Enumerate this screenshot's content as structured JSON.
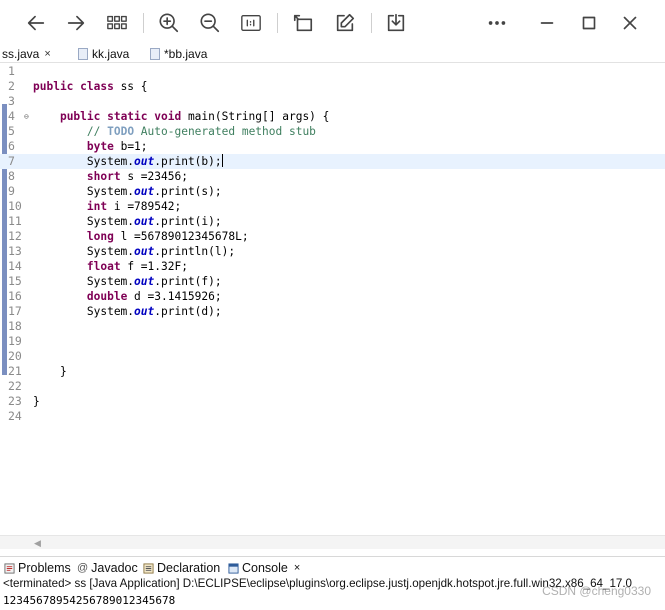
{
  "editor_tabs": [
    {
      "label": "ss.java",
      "close": "×"
    },
    {
      "label": "kk.java",
      "close": ""
    },
    {
      "label": "*bb.java",
      "close": ""
    }
  ],
  "code_lines": [
    {
      "n": "1",
      "fold": "",
      "current": false,
      "tokens": []
    },
    {
      "n": "2",
      "fold": "",
      "current": false,
      "tokens": [
        {
          "t": "public class",
          "c": "kw"
        },
        {
          "t": " ss {",
          "c": ""
        }
      ]
    },
    {
      "n": "3",
      "fold": "",
      "current": false,
      "tokens": []
    },
    {
      "n": "4",
      "fold": "⊖",
      "current": false,
      "tokens": [
        {
          "t": "    ",
          "c": ""
        },
        {
          "t": "public static void",
          "c": "kw"
        },
        {
          "t": " main(String[] args) {",
          "c": ""
        }
      ]
    },
    {
      "n": "5",
      "fold": "",
      "current": false,
      "tokens": [
        {
          "t": "        ",
          "c": ""
        },
        {
          "t": "// ",
          "c": "cm"
        },
        {
          "t": "TODO",
          "c": "todo"
        },
        {
          "t": " Auto-generated method stub",
          "c": "cm"
        }
      ]
    },
    {
      "n": "6",
      "fold": "",
      "current": false,
      "tokens": [
        {
          "t": "        ",
          "c": ""
        },
        {
          "t": "byte",
          "c": "kw"
        },
        {
          "t": " b=1;",
          "c": ""
        }
      ]
    },
    {
      "n": "7",
      "fold": "",
      "current": true,
      "tokens": [
        {
          "t": "        System.",
          "c": ""
        },
        {
          "t": "out",
          "c": "fld"
        },
        {
          "t": ".print(b);",
          "c": ""
        },
        {
          "t": "|",
          "c": "cursor"
        }
      ]
    },
    {
      "n": "8",
      "fold": "",
      "current": false,
      "tokens": [
        {
          "t": "        ",
          "c": ""
        },
        {
          "t": "short",
          "c": "kw"
        },
        {
          "t": " s =23456;",
          "c": ""
        }
      ]
    },
    {
      "n": "9",
      "fold": "",
      "current": false,
      "tokens": [
        {
          "t": "        System.",
          "c": ""
        },
        {
          "t": "out",
          "c": "fld"
        },
        {
          "t": ".print(s);",
          "c": ""
        }
      ]
    },
    {
      "n": "10",
      "fold": "",
      "current": false,
      "tokens": [
        {
          "t": "        ",
          "c": ""
        },
        {
          "t": "int",
          "c": "kw"
        },
        {
          "t": " i =789542;",
          "c": ""
        }
      ]
    },
    {
      "n": "11",
      "fold": "",
      "current": false,
      "tokens": [
        {
          "t": "        System.",
          "c": ""
        },
        {
          "t": "out",
          "c": "fld"
        },
        {
          "t": ".print(i);",
          "c": ""
        }
      ]
    },
    {
      "n": "12",
      "fold": "",
      "current": false,
      "tokens": [
        {
          "t": "        ",
          "c": ""
        },
        {
          "t": "long",
          "c": "kw"
        },
        {
          "t": " l =56789012345678L;",
          "c": ""
        }
      ]
    },
    {
      "n": "13",
      "fold": "",
      "current": false,
      "tokens": [
        {
          "t": "        System.",
          "c": ""
        },
        {
          "t": "out",
          "c": "fld"
        },
        {
          "t": ".println(l);",
          "c": ""
        }
      ]
    },
    {
      "n": "14",
      "fold": "",
      "current": false,
      "tokens": [
        {
          "t": "        ",
          "c": ""
        },
        {
          "t": "float",
          "c": "kw"
        },
        {
          "t": " f =1.32F;",
          "c": ""
        }
      ]
    },
    {
      "n": "15",
      "fold": "",
      "current": false,
      "tokens": [
        {
          "t": "        System.",
          "c": ""
        },
        {
          "t": "out",
          "c": "fld"
        },
        {
          "t": ".print(f);",
          "c": ""
        }
      ]
    },
    {
      "n": "16",
      "fold": "",
      "current": false,
      "tokens": [
        {
          "t": "        ",
          "c": ""
        },
        {
          "t": "double",
          "c": "kw"
        },
        {
          "t": " d =3.1415926;",
          "c": ""
        }
      ]
    },
    {
      "n": "17",
      "fold": "",
      "current": false,
      "tokens": [
        {
          "t": "        System.",
          "c": ""
        },
        {
          "t": "out",
          "c": "fld"
        },
        {
          "t": ".print(d);",
          "c": ""
        }
      ]
    },
    {
      "n": "18",
      "fold": "",
      "current": false,
      "tokens": []
    },
    {
      "n": "19",
      "fold": "",
      "current": false,
      "tokens": []
    },
    {
      "n": "20",
      "fold": "",
      "current": false,
      "tokens": []
    },
    {
      "n": "21",
      "fold": "",
      "current": false,
      "tokens": [
        {
          "t": "    }",
          "c": ""
        }
      ]
    },
    {
      "n": "22",
      "fold": "",
      "current": false,
      "tokens": []
    },
    {
      "n": "23",
      "fold": "",
      "current": false,
      "tokens": [
        {
          "t": "}",
          "c": ""
        }
      ]
    },
    {
      "n": "24",
      "fold": "",
      "current": false,
      "tokens": []
    }
  ],
  "view_tabs": {
    "problems": "Problems",
    "javadoc": "Javadoc",
    "declaration": "Declaration",
    "console": "Console",
    "console_close": "×"
  },
  "console": {
    "status": "<terminated> ss [Java Application] D:\\ECLIPSE\\eclipse\\plugins\\org.eclipse.justj.openjdk.hotspot.jre.full.win32.x86_64_17.0",
    "output": "12345678954256789012345678"
  },
  "watermark": "CSDN @cheng0330",
  "colors": {
    "keyword": "#7f0055",
    "comment": "#3f7f5f",
    "field": "#0000c0",
    "current_line": "#e8f2fe"
  }
}
